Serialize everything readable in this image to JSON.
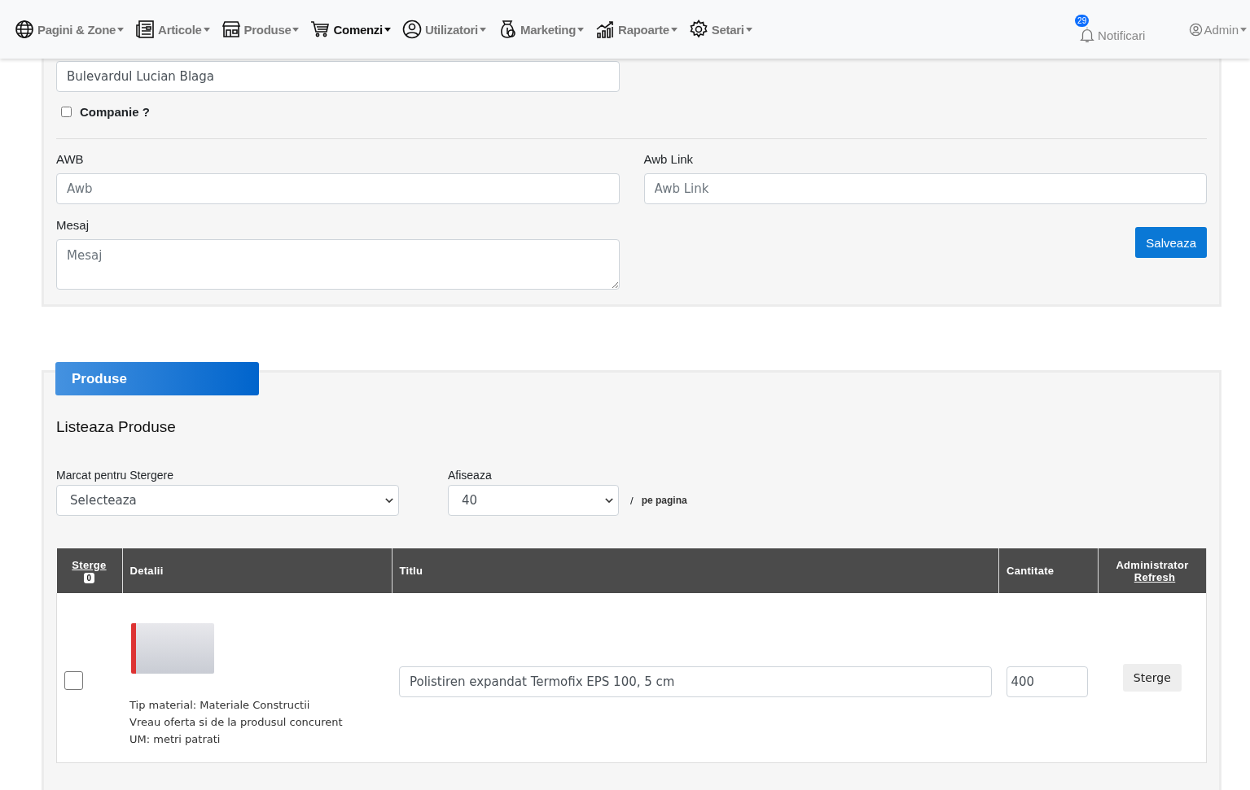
{
  "nav": {
    "items": [
      {
        "label": "Pagini & Zone",
        "selected": false
      },
      {
        "label": "Articole",
        "selected": false
      },
      {
        "label": "Produse",
        "selected": false
      },
      {
        "label": "Comenzi",
        "selected": true
      },
      {
        "label": "Utilizatori",
        "selected": false
      },
      {
        "label": "Marketing",
        "selected": false
      },
      {
        "label": "Rapoarte",
        "selected": false
      },
      {
        "label": "Setari",
        "selected": false
      }
    ],
    "notifications": {
      "count": "29",
      "label": "Notificari"
    },
    "user": {
      "label": "Admin"
    }
  },
  "order_form": {
    "street": {
      "value": "Bulevardul Lucian Blaga"
    },
    "company": {
      "label": "Companie ?",
      "checked": false
    },
    "awb": {
      "label": "AWB",
      "placeholder": "Awb"
    },
    "awb_link": {
      "label": "Awb Link",
      "placeholder": "Awb Link"
    },
    "message": {
      "label": "Mesaj",
      "placeholder": "Mesaj"
    },
    "save_button": "Salveaza"
  },
  "products": {
    "tab": "Produse",
    "heading": "Listeaza Produse",
    "marked_filter": {
      "label": "Marcat pentru Stergere",
      "value": "Selecteaza"
    },
    "page_size": {
      "label": "Afiseaza",
      "value": "40",
      "separator": "/",
      "suffix": "pe pagina"
    },
    "table": {
      "columns": {
        "delete": {
          "label": "Sterge",
          "count": "0"
        },
        "details": "Detalii",
        "title": "Titlu",
        "quantity": "Cantitate",
        "admin": {
          "label": "Administrator",
          "link": "Refresh"
        }
      },
      "rows": [
        {
          "checked": false,
          "details": [
            "Tip material: Materiale Constructii",
            "Vreau oferta si de la produsul concurent",
            "UM: metri patrati"
          ],
          "title": "Polistiren expandat Termofix EPS 100, 5 cm",
          "quantity": "400",
          "action": "Sterge"
        }
      ]
    }
  }
}
